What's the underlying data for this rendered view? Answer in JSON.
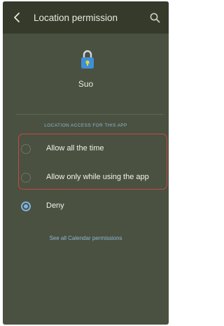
{
  "header": {
    "back_icon": "back-arrow-icon",
    "title": "Location permission",
    "search_icon": "search-icon"
  },
  "app": {
    "icon": "padlock-icon",
    "name": "Suo"
  },
  "section_header": "LOCATION ACCESS FOR THIS APP",
  "options": [
    {
      "label": "Allow all the time",
      "selected": false
    },
    {
      "label": "Allow only while using the app",
      "selected": false
    },
    {
      "label": "Deny",
      "selected": true
    }
  ],
  "footer_link": "See all Calendar permissions",
  "colors": {
    "background": "#4a5140",
    "app_bar": "#353a2b",
    "accent": "#7fb3e0",
    "highlight_border": "#c54a4a"
  }
}
